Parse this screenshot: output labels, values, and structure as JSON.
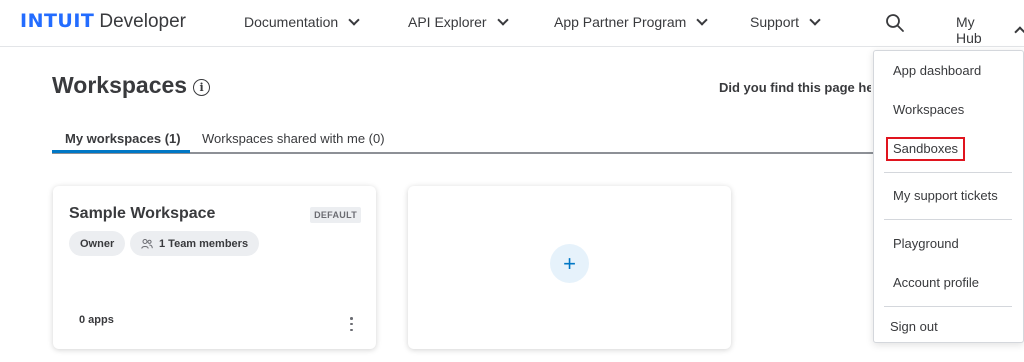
{
  "nav": {
    "brand": "INTUIT",
    "product": "Developer",
    "items": [
      {
        "label": "Documentation"
      },
      {
        "label": "API Explorer"
      },
      {
        "label": "App Partner Program"
      },
      {
        "label": "Support"
      }
    ],
    "search_icon": "search-icon",
    "hub_label": "My Hub"
  },
  "page": {
    "title": "Workspaces",
    "info_glyph": "i",
    "feedback_text": "Did you find this page helpful?"
  },
  "tabs": [
    {
      "label": "My workspaces (1)",
      "active": true
    },
    {
      "label": "Workspaces shared with me (0)",
      "active": false
    }
  ],
  "workspace_card": {
    "title": "Sample Workspace",
    "badge": "DEFAULT",
    "role_chip": "Owner",
    "members_chip": "1 Team members",
    "apps": "0 apps"
  },
  "add_card": {
    "plus": "+"
  },
  "hub_menu": {
    "items": [
      {
        "label": "App dashboard"
      },
      {
        "label": "Workspaces"
      },
      {
        "label": "Sandboxes",
        "highlighted": true
      },
      {
        "label": "My support tickets"
      },
      {
        "label": "Playground"
      },
      {
        "label": "Account profile"
      },
      {
        "label": "Sign out"
      }
    ]
  },
  "colors": {
    "brand_blue": "#236cff",
    "accent_blue": "#0077c5",
    "highlight_red": "#e0141e",
    "text": "#393a3d"
  }
}
